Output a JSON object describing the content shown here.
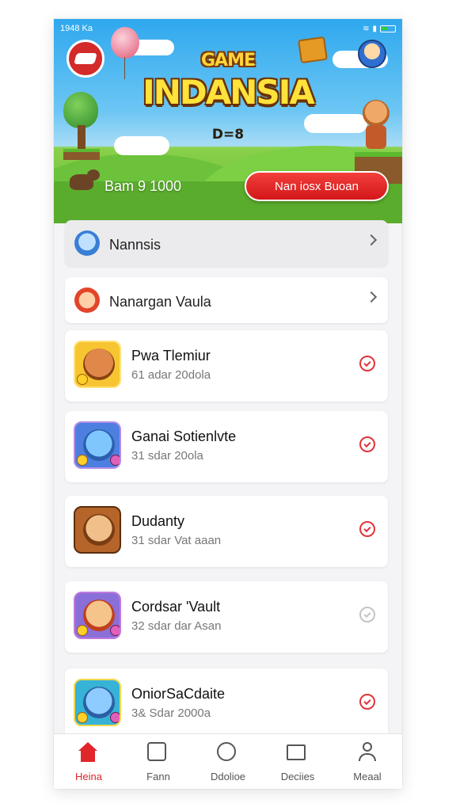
{
  "status_bar": {
    "time": "1948 Ka"
  },
  "banner": {
    "title_small": "GAME",
    "title_main": "INDANSIA",
    "code": "D=8",
    "balance": "Bam 9 1000",
    "cta_label": "Nan iosx Buoan"
  },
  "menu": [
    {
      "label": "Nannsis",
      "highlighted": true
    },
    {
      "label": "Nanargan Vaula",
      "highlighted": false
    }
  ],
  "games": [
    {
      "title": "Pwa Tlemiur",
      "subtitle": "61 adar 20dola",
      "checked": true
    },
    {
      "title": "Ganai Sotienlvte",
      "subtitle": "31 sdar 20ola",
      "checked": true
    },
    {
      "title": "Dudanty",
      "subtitle": "31 sdar Vat aaan",
      "checked": true
    },
    {
      "title": "Cordsar 'Vault",
      "subtitle": "32 sdar dar Asan",
      "checked": false
    },
    {
      "title": "OniorSaCdaite",
      "subtitle": "3& Sdar 2000a",
      "checked": true
    }
  ],
  "bottom_nav": [
    {
      "label": "Heina",
      "icon": "home-icon",
      "active": true
    },
    {
      "label": "Fann",
      "icon": "games-icon",
      "active": false
    },
    {
      "label": "Ddolioe",
      "icon": "compass-icon",
      "active": false
    },
    {
      "label": "Deciies",
      "icon": "inbox-icon",
      "active": false
    },
    {
      "label": "Meaal",
      "icon": "profile-icon",
      "active": false
    }
  ],
  "colors": {
    "accent": "#e0262b",
    "muted": "#c4c4c4"
  }
}
